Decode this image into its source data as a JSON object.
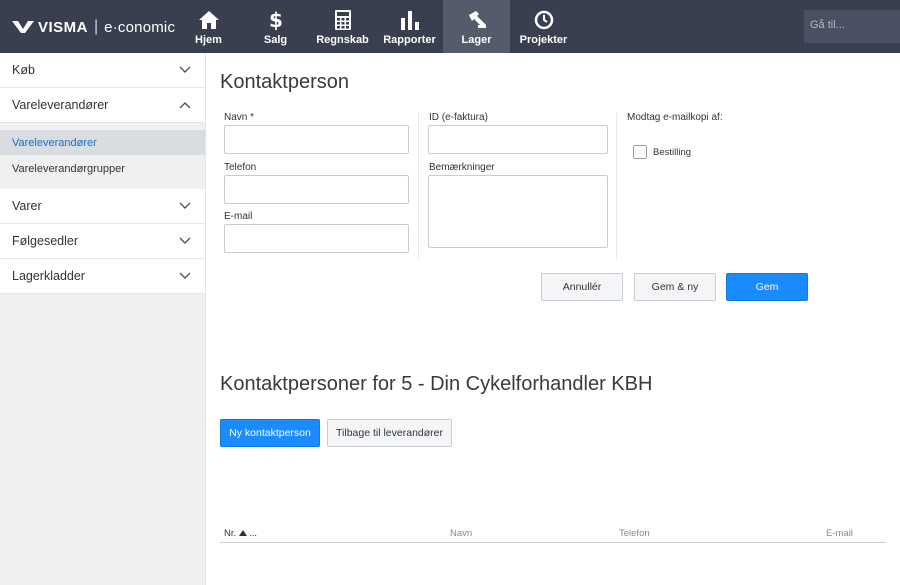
{
  "logo": {
    "brand": "VISMA",
    "separator": "|",
    "product": "e·conomic"
  },
  "nav": {
    "items": [
      {
        "label": "Hjem",
        "icon": "home-icon"
      },
      {
        "label": "Salg",
        "icon": "dollar-icon"
      },
      {
        "label": "Regnskab",
        "icon": "calculator-icon"
      },
      {
        "label": "Rapporter",
        "icon": "bar-chart-icon"
      },
      {
        "label": "Lager",
        "icon": "hammer-icon",
        "active": true
      },
      {
        "label": "Projekter",
        "icon": "clock-icon"
      }
    ],
    "goto_placeholder": "Gå til..."
  },
  "sidebar": {
    "sections": [
      {
        "label": "Køb",
        "expanded": false
      },
      {
        "label": "Vareleverandører",
        "expanded": true,
        "links": [
          {
            "label": "Vareleverandører",
            "current": true
          },
          {
            "label": "Vareleverandørgrupper"
          }
        ]
      },
      {
        "label": "Varer",
        "expanded": false
      },
      {
        "label": "Følgesedler",
        "expanded": false
      },
      {
        "label": "Lagerkladder",
        "expanded": false
      }
    ]
  },
  "form": {
    "title": "Kontaktperson",
    "name_label": "Navn *",
    "phone_label": "Telefon",
    "email_label": "E-mail",
    "efaktura_label": "ID (e-faktura)",
    "notes_label": "Bemærkninger",
    "mailcopy_label": "Modtag e-mailkopi af:",
    "order_checkbox_label": "Bestilling",
    "cancel_label": "Annullér",
    "save_new_label": "Gem & ny",
    "save_label": "Gem"
  },
  "list": {
    "title": "Kontaktpersoner for 5 - Din Cykelforhandler KBH",
    "new_button": "Ny kontaktperson",
    "back_button": "Tilbage til leverandører",
    "columns": {
      "nr": "Nr.",
      "nr_more": "...",
      "name": "Navn",
      "phone": "Telefon",
      "email": "E-mail"
    }
  },
  "colors": {
    "topbar": "#393f4f",
    "nav_active": "#555b6a",
    "primary": "#1a8cff",
    "link": "#1a6fc7"
  }
}
